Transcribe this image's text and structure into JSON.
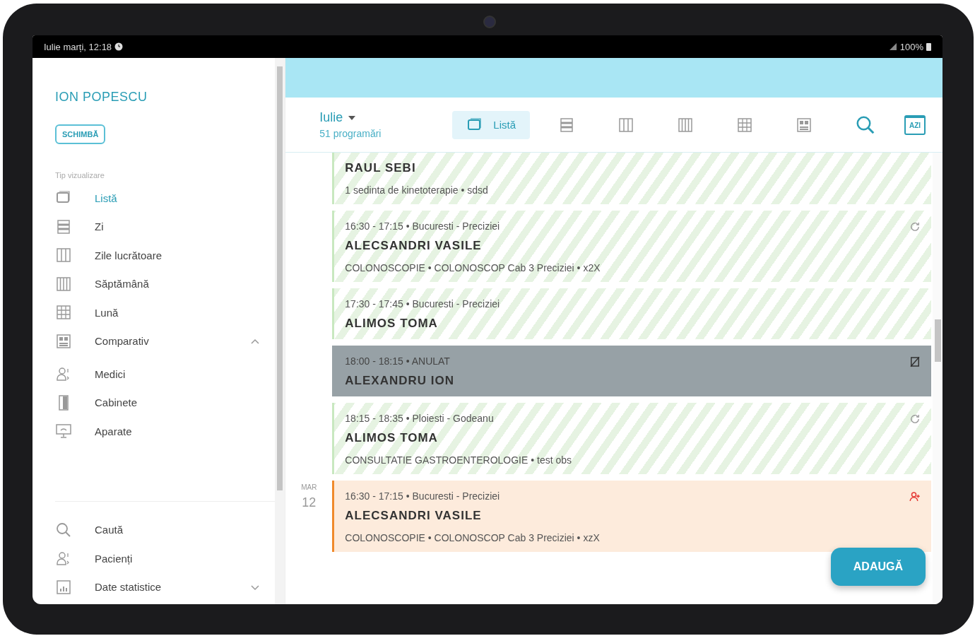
{
  "status_bar": {
    "date_time": "Iulie marți, 12:18",
    "battery": "100%"
  },
  "sidebar": {
    "user_name": "ION POPESCU",
    "switch_button": "SCHIMBĂ",
    "section_label": "Tip vizualizare",
    "items": [
      {
        "kind": "list",
        "label": "Listă",
        "selected": true
      },
      {
        "kind": "day",
        "label": "Zi",
        "selected": false
      },
      {
        "kind": "workweek",
        "label": "Zile lucrătoare",
        "selected": false
      },
      {
        "kind": "week",
        "label": "Săptămână",
        "selected": false
      },
      {
        "kind": "month",
        "label": "Lună",
        "selected": false
      },
      {
        "kind": "compare",
        "label": "Comparativ",
        "selected": false,
        "expanded": true,
        "children": [
          {
            "kind": "people",
            "label": "Medici",
            "selected": false
          },
          {
            "kind": "door",
            "label": "Cabinete",
            "selected": false
          },
          {
            "kind": "device",
            "label": "Aparate",
            "selected": false
          }
        ]
      }
    ],
    "bottom_items": [
      {
        "kind": "search",
        "label": "Caută",
        "selected": false
      },
      {
        "kind": "people",
        "label": "Pacienți",
        "selected": false
      },
      {
        "kind": "stats",
        "label": "Date statistice",
        "selected": false,
        "expanded": false
      }
    ]
  },
  "toolbar": {
    "month": "Iulie",
    "count": "51 programări",
    "views": [
      {
        "kind": "list",
        "label": "Listă",
        "selected": true
      },
      {
        "kind": "day",
        "selected": false
      },
      {
        "kind": "workweek",
        "selected": false
      },
      {
        "kind": "week",
        "selected": false
      },
      {
        "kind": "month",
        "selected": false
      },
      {
        "kind": "compare",
        "selected": false
      }
    ],
    "today_button": "AZI"
  },
  "days": [
    {
      "appointments": [
        {
          "kind": "confirmed",
          "name": "RAUL SEBI",
          "details": "1 sedinta de kinetoterapie • sdsd",
          "recurring": false
        },
        {
          "kind": "confirmed",
          "time": "16:30 - 17:15 • Bucuresti - Preciziei",
          "name": "ALECSANDRI VASILE",
          "details": "COLONOSCOPIE • COLONOSCOP Cab 3 Preciziei • x2X",
          "recurring": true
        },
        {
          "kind": "confirmed",
          "time": "17:30 - 17:45 • Bucuresti - Preciziei",
          "name": "ALIMOS TOMA",
          "recurring": false
        },
        {
          "kind": "cancelled",
          "time": "18:00 - 18:15 • ANULAT",
          "name": "ALEXANDRU ION",
          "recurring": false
        },
        {
          "kind": "confirmed",
          "time": "18:15 - 18:35 • Ploiesti - Godeanu",
          "name": "ALIMOS TOMA",
          "details": "CONSULTATIE GASTROENTEROLOGIE • test obs",
          "recurring": true
        }
      ]
    },
    {
      "day_name": "MAR",
      "day_number": "12",
      "appointments": [
        {
          "kind": "pending",
          "time": "16:30 - 17:15 • Bucuresti - Preciziei",
          "name": "ALECSANDRI VASILE",
          "details": "COLONOSCOPIE • COLONOSCOP Cab 3 Preciziei • xzX",
          "recurring": false
        }
      ]
    }
  ],
  "add_button": "ADAUGĂ"
}
